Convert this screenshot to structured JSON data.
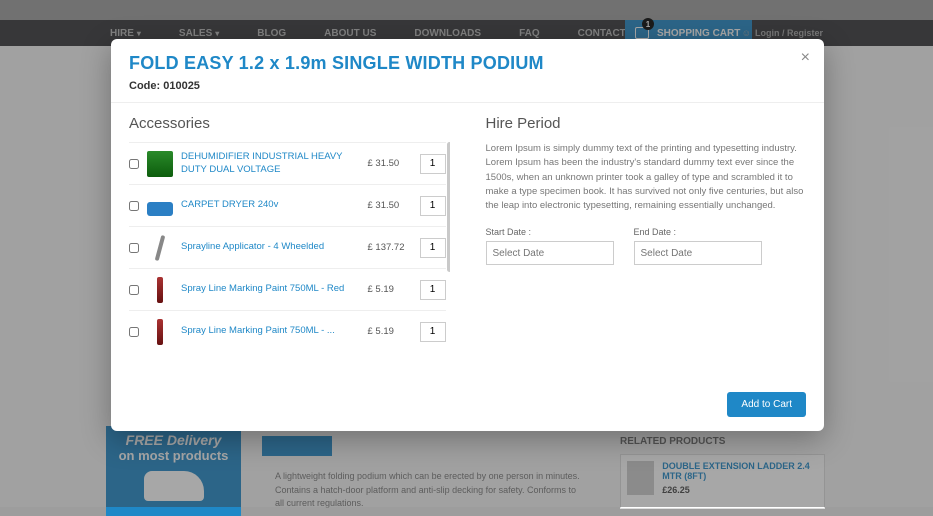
{
  "nav": {
    "items": [
      "HIRE",
      "SALES",
      "BLOG",
      "ABOUT US",
      "DOWNLOADS",
      "FAQ",
      "CONTACT US"
    ],
    "cart_label": "SHOPPING CART",
    "cart_count": "1",
    "login_label": "Login / Register"
  },
  "bg": {
    "delivery_line1": "FREE Delivery",
    "delivery_line2": "on most products",
    "desc": "A lightweight folding podium which can be erected by one person in minutes. Contains a hatch-door platform and anti-slip decking for safety. Conforms to all current regulations.",
    "related_head": "RELATED PRODUCTS",
    "related_name": "DOUBLE EXTENSION LADDER 2.4 MTR (8FT)",
    "related_price": "£26.25"
  },
  "modal": {
    "title": "FOLD EASY 1.2 x 1.9m SINGLE WIDTH PODIUM",
    "code_label": "Code: 010025",
    "accessories_title": "Accessories",
    "hire_title": "Hire Period",
    "hire_text": "Lorem Ipsum is simply dummy text of the printing and typesetting industry. Lorem Ipsum has been the industry's standard dummy text ever since the 1500s, when an unknown printer took a galley of type and scrambled it to make a type specimen book. It has survived not only five centuries, but also the leap into electronic typesetting, remaining essentially unchanged.",
    "start_label": "Start Date :",
    "end_label": "End Date :",
    "date_placeholder": "Select Date",
    "add_to_cart": "Add to Cart",
    "close": "×",
    "accessories": [
      {
        "name": "DEHUMIDIFIER INDUSTRIAL HEAVY DUTY DUAL VOLTAGE",
        "price": "£ 31.50",
        "qty": "1",
        "thumb": "thumb-green"
      },
      {
        "name": "CARPET DRYER 240v",
        "price": "£ 31.50",
        "qty": "1",
        "thumb": "thumb-blue"
      },
      {
        "name": "Sprayline Applicator - 4 Wheelded",
        "price": "£ 137.72",
        "qty": "1",
        "thumb": "thumb-line"
      },
      {
        "name": "Spray Line Marking Paint 750ML - Red",
        "price": "£ 5.19",
        "qty": "1",
        "thumb": "thumb-bar"
      },
      {
        "name": "Spray Line Marking Paint 750ML - ...",
        "price": "£ 5.19",
        "qty": "1",
        "thumb": "thumb-bar"
      }
    ]
  }
}
